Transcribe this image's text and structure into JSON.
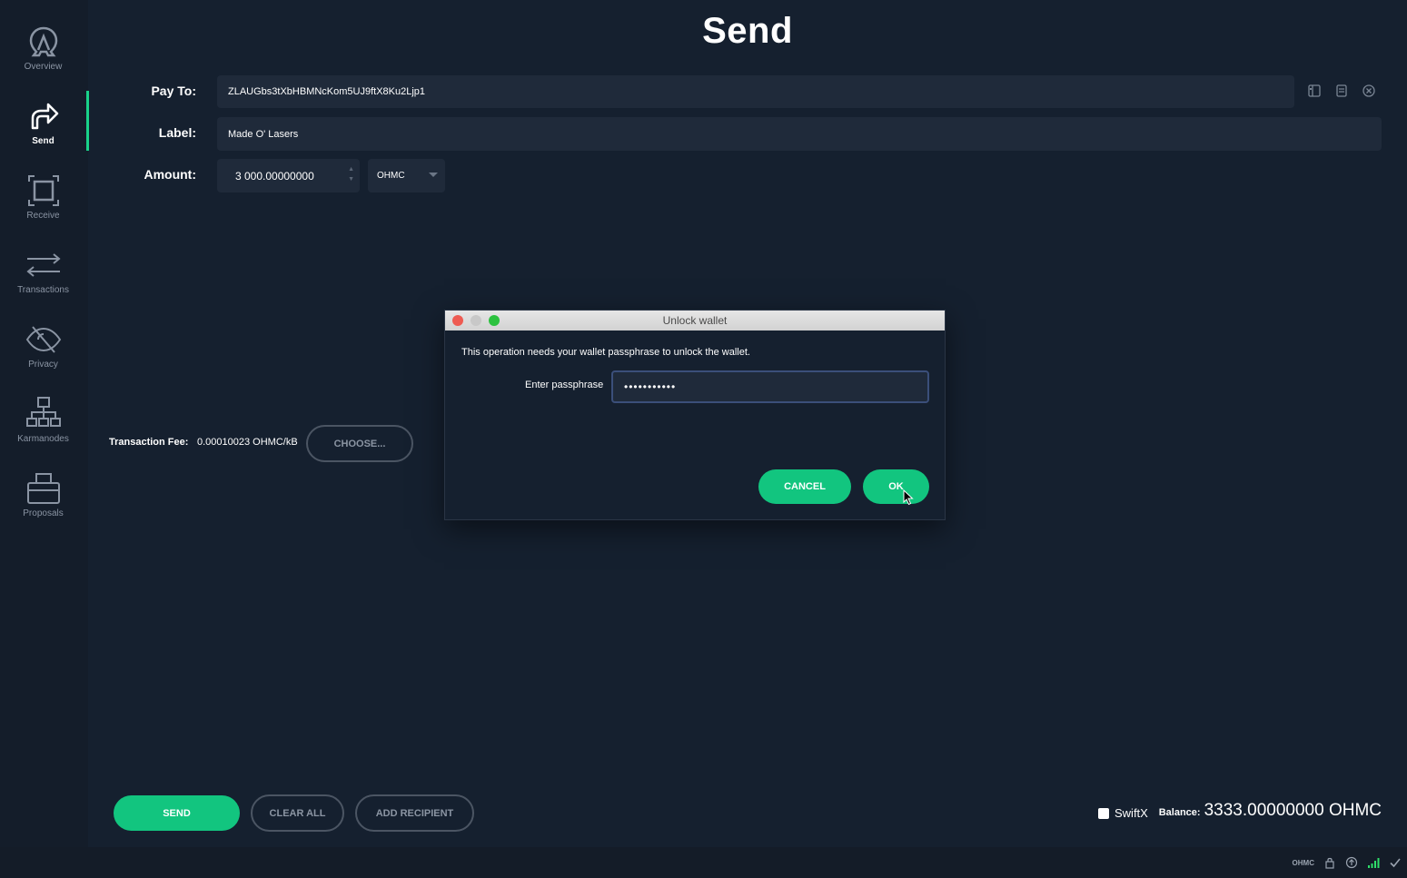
{
  "header": {
    "title": "Send"
  },
  "sidebar": {
    "items": [
      {
        "label": "Overview",
        "icon": "logo-icon"
      },
      {
        "label": "Send",
        "icon": "send-arrow-icon",
        "active": true
      },
      {
        "label": "Receive",
        "icon": "receive-frame-icon"
      },
      {
        "label": "Transactions",
        "icon": "transactions-arrows-icon"
      },
      {
        "label": "Privacy",
        "icon": "eye-slash-icon"
      },
      {
        "label": "Karmanodes",
        "icon": "network-tree-icon"
      },
      {
        "label": "Proposals",
        "icon": "ballot-box-icon"
      }
    ]
  },
  "form": {
    "pay_to_label": "Pay To:",
    "pay_to_value": "ZLAUGbs3tXbHBMNcKom5UJ9ftX8Ku2Ljp1",
    "label_label": "Label:",
    "label_value": "Made O' Lasers",
    "amount_label": "Amount:",
    "amount_value": "3 000.00000000",
    "unit_value": "OHMC"
  },
  "fee": {
    "label": "Transaction Fee:",
    "value": "0.00010023 OHMC/kB",
    "choose_label": "CHOOSE..."
  },
  "dialog": {
    "title": "Unlock wallet",
    "message": "This operation needs your wallet passphrase to unlock the wallet.",
    "passphrase_label": "Enter passphrase",
    "passphrase_value": "•••••••••••",
    "cancel_label": "CANCEL",
    "ok_label": "OK"
  },
  "bottom": {
    "send_label": "SEND",
    "clear_all_label": "CLEAR ALL",
    "add_recipient_label": "ADD RECIPIENT",
    "swiftx_label": "SwiftX",
    "balance_label": "Balance:",
    "balance_value": "3333.00000000 OHMC"
  },
  "statusbar": {
    "unit": "OHMC"
  },
  "colors": {
    "accent": "#12c57f",
    "background": "#15202f",
    "field": "#1f2a3a"
  }
}
